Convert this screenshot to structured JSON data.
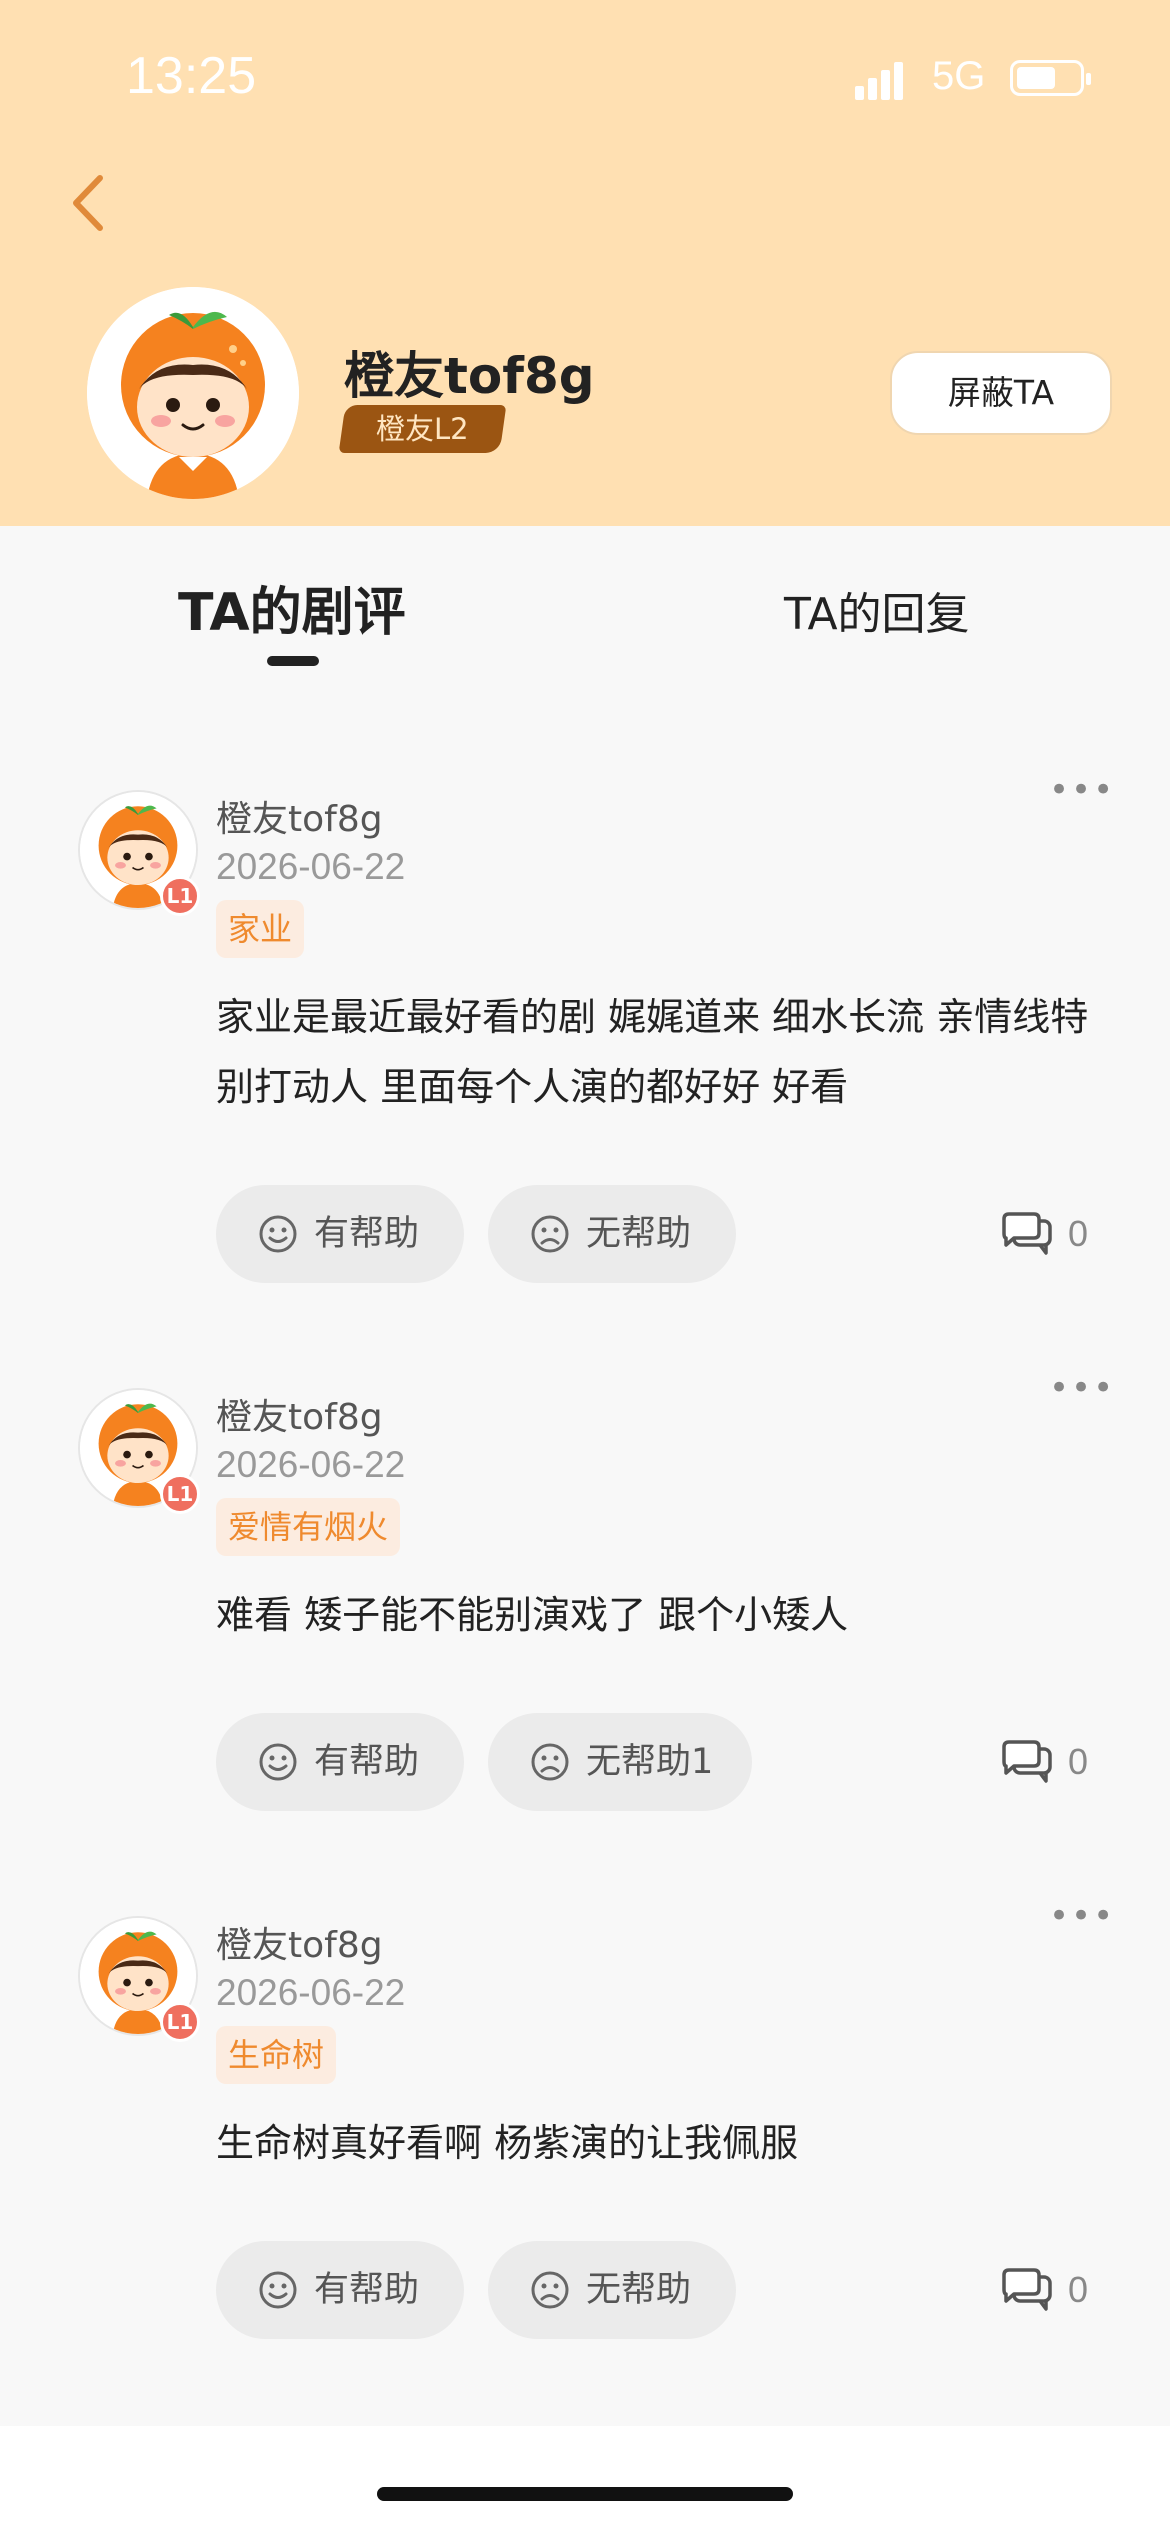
{
  "status_bar": {
    "time": "13:25",
    "network": "5G"
  },
  "profile": {
    "name": "橙友tof8g",
    "level": "橙友L2",
    "block_button": "屏蔽TA"
  },
  "tabs": [
    {
      "label": "TA的剧评",
      "active": true
    },
    {
      "label": "TA的回复",
      "active": false
    }
  ],
  "reviews": [
    {
      "user": "橙友tof8g",
      "level": "L1",
      "date": "2026-06-22",
      "tag": "家业",
      "text": "家业是最近最好看的剧 娓娓道来 细水长流 亲情线特别打动人 里面每个人演的都好好 好看",
      "helpful_label": "有帮助",
      "unhelpful_label": "无帮助",
      "comment_count": "0"
    },
    {
      "user": "橙友tof8g",
      "level": "L1",
      "date": "2026-06-22",
      "tag": "爱情有烟火",
      "text": "难看 矮子能不能别演戏了 跟个小矮人",
      "helpful_label": "有帮助",
      "unhelpful_label": "无帮助1",
      "comment_count": "0"
    },
    {
      "user": "橙友tof8g",
      "level": "L1",
      "date": "2026-06-22",
      "tag": "生命树",
      "text": "生命树真好看啊 杨紫演的让我佩服",
      "helpful_label": "有帮助",
      "unhelpful_label": "无帮助",
      "comment_count": "0"
    }
  ],
  "colors": {
    "header_bg": "#ffe0b2",
    "level_badge": "#9b5512",
    "tag_text": "#ef8a2e",
    "tag_bg": "#fcece0",
    "pill_bg": "#ebebeb",
    "back_arrow": "#e08a3a"
  }
}
